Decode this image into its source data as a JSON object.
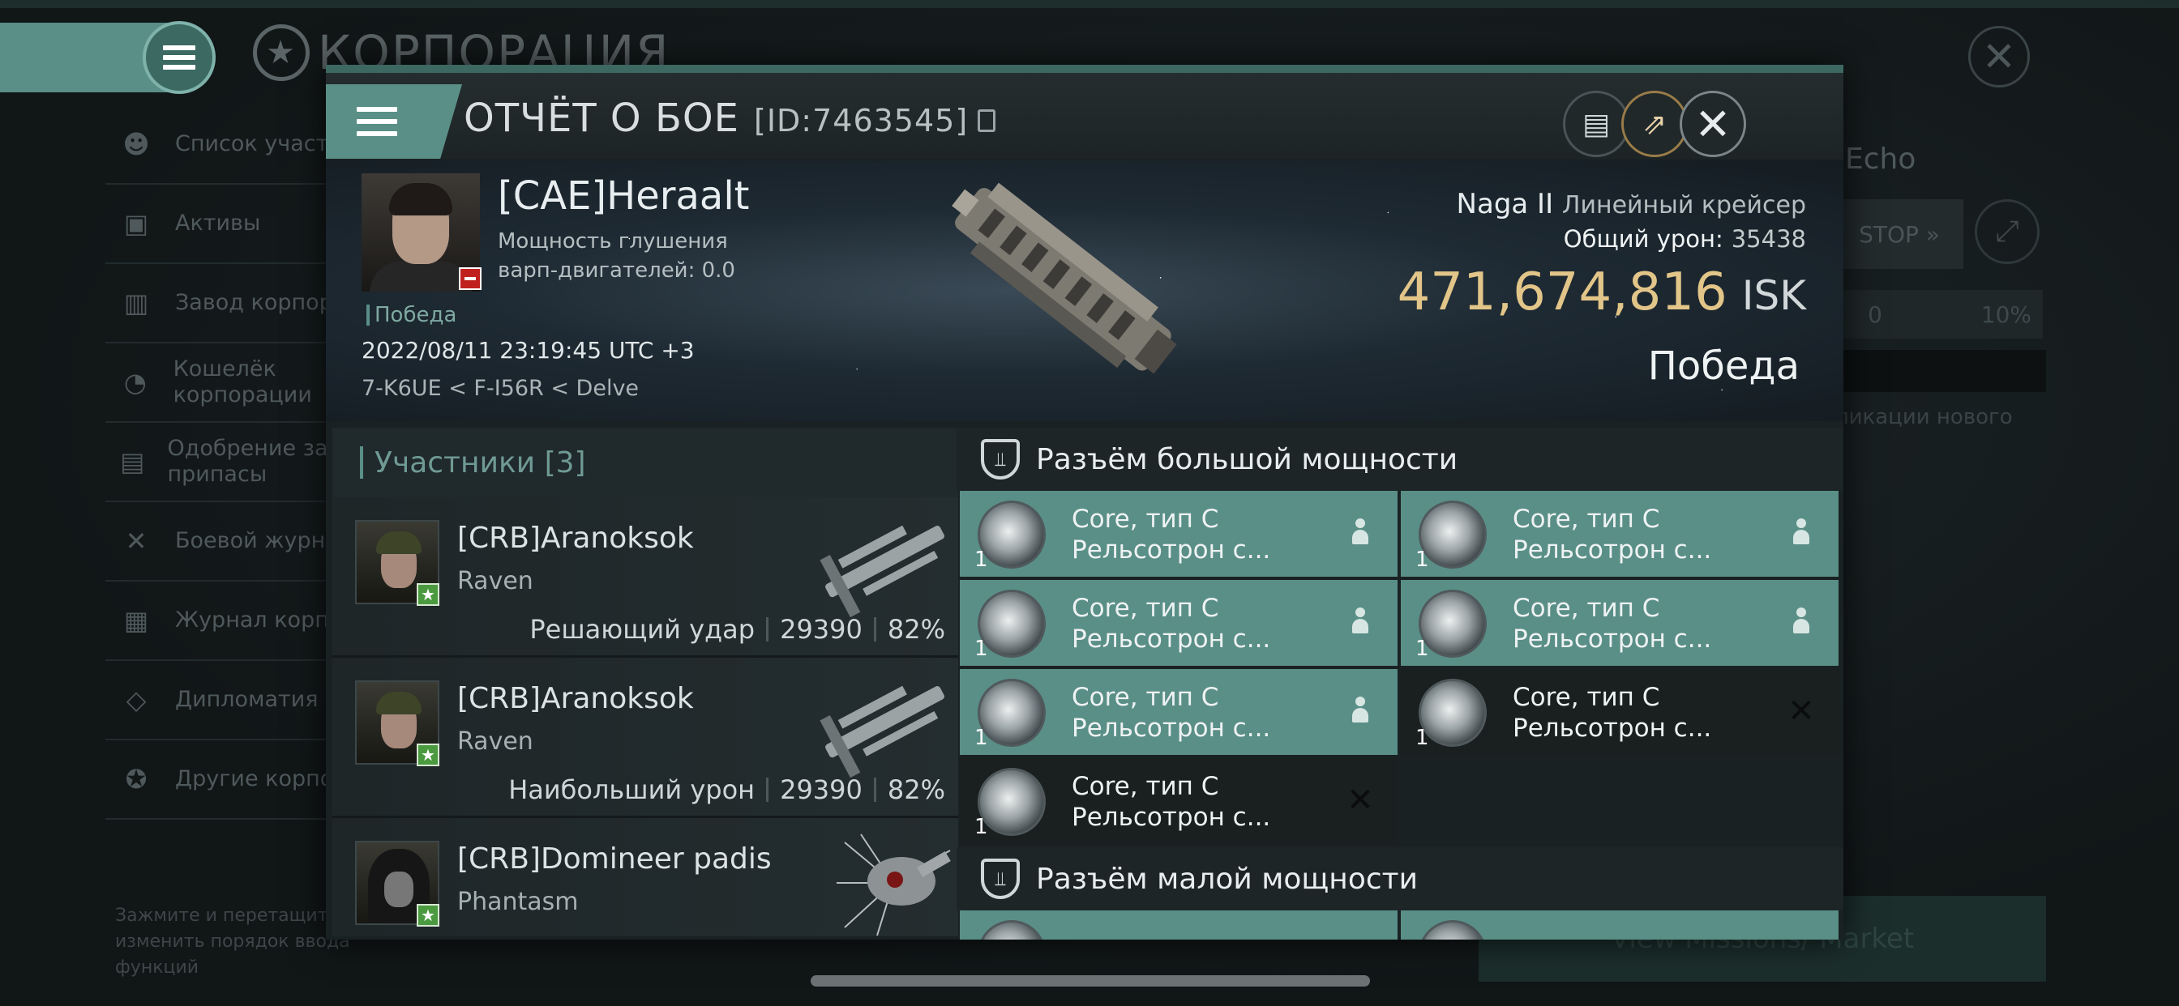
{
  "background": {
    "corp_title": "КОРПОРАЦИЯ",
    "sidebar": [
      {
        "label": "Список участн",
        "icon": "members-icon"
      },
      {
        "label": "Активы",
        "icon": "assets-icon"
      },
      {
        "label": "Завод корпора",
        "icon": "factory-icon"
      },
      {
        "label": "Кошелёк корпорации",
        "icon": "wallet-icon"
      },
      {
        "label": "Одобрение зая на припасы",
        "icon": "supply-icon"
      },
      {
        "label": "Боевой журнал",
        "icon": "combat-log-icon"
      },
      {
        "label": "Журнал корпор",
        "icon": "journal-icon"
      },
      {
        "label": "Дипломатия",
        "icon": "diplomacy-icon"
      },
      {
        "label": "Другие корпор",
        "icon": "star-icon"
      }
    ],
    "hint": "Зажмите и перетащите изменить порядок ввода функций",
    "right": {
      "echo": "Echo",
      "stop": "STOP",
      "zero": "0",
      "pct": "10%",
      "text": "ликации нового",
      "button": "View Missions/ Market"
    }
  },
  "modal": {
    "title": "ОТЧЁТ О БОЕ",
    "id": "[ID:7463545]",
    "victim": {
      "name": "[CAE]Heraalt",
      "stat_line1": "Мощность глушения",
      "stat_line2": "варп-двигателей: 0.0",
      "victory_tag": "Победа",
      "datetime": "2022/08/11 23:19:45 UTC +3",
      "location": "7-K6UE < F-I56R < Delve",
      "ship_name": "Naga II",
      "ship_class": "Линейный крейсер",
      "total_damage_label": "Общий урон:",
      "total_damage": "35438",
      "isk_value": "471,674,816",
      "isk_unit": "ISK",
      "result": "Победа"
    },
    "participants": {
      "title": "Участники",
      "count": "[3]",
      "rows": [
        {
          "name": "[CRB]Aranoksok",
          "ship": "Raven",
          "role": "Решающий удар",
          "damage": "29390",
          "percent": "82%"
        },
        {
          "name": "[CRB]Aranoksok",
          "ship": "Raven",
          "role": "Наибольший урон",
          "damage": "29390",
          "percent": "82%"
        },
        {
          "name": "[CRB]Domineer padis",
          "ship": "Phantasm",
          "role": "",
          "damage": "",
          "percent": ""
        }
      ]
    },
    "slots": {
      "high_title": "Разъём большой мощности",
      "low_title": "Разъём малой мощности",
      "high": [
        {
          "line1": "Core, тип C",
          "line2": "Рельсотрон с...",
          "qty": "1",
          "state": "fit"
        },
        {
          "line1": "Core, тип C",
          "line2": "Рельсотрон с...",
          "qty": "1",
          "state": "fit"
        },
        {
          "line1": "Core, тип C",
          "line2": "Рельсотрон с...",
          "qty": "1",
          "state": "fit"
        },
        {
          "line1": "Core, тип C",
          "line2": "Рельсотрон с...",
          "qty": "1",
          "state": "fit"
        },
        {
          "line1": "Core, тип C",
          "line2": "Рельсотрон с...",
          "qty": "1",
          "state": "fit"
        },
        {
          "line1": "Core, тип C",
          "line2": "Рельсотрон с...",
          "qty": "1",
          "state": "lost"
        },
        {
          "line1": "Core, тип C",
          "line2": "Рельсотрон с...",
          "qty": "1",
          "state": "lost"
        }
      ]
    }
  }
}
